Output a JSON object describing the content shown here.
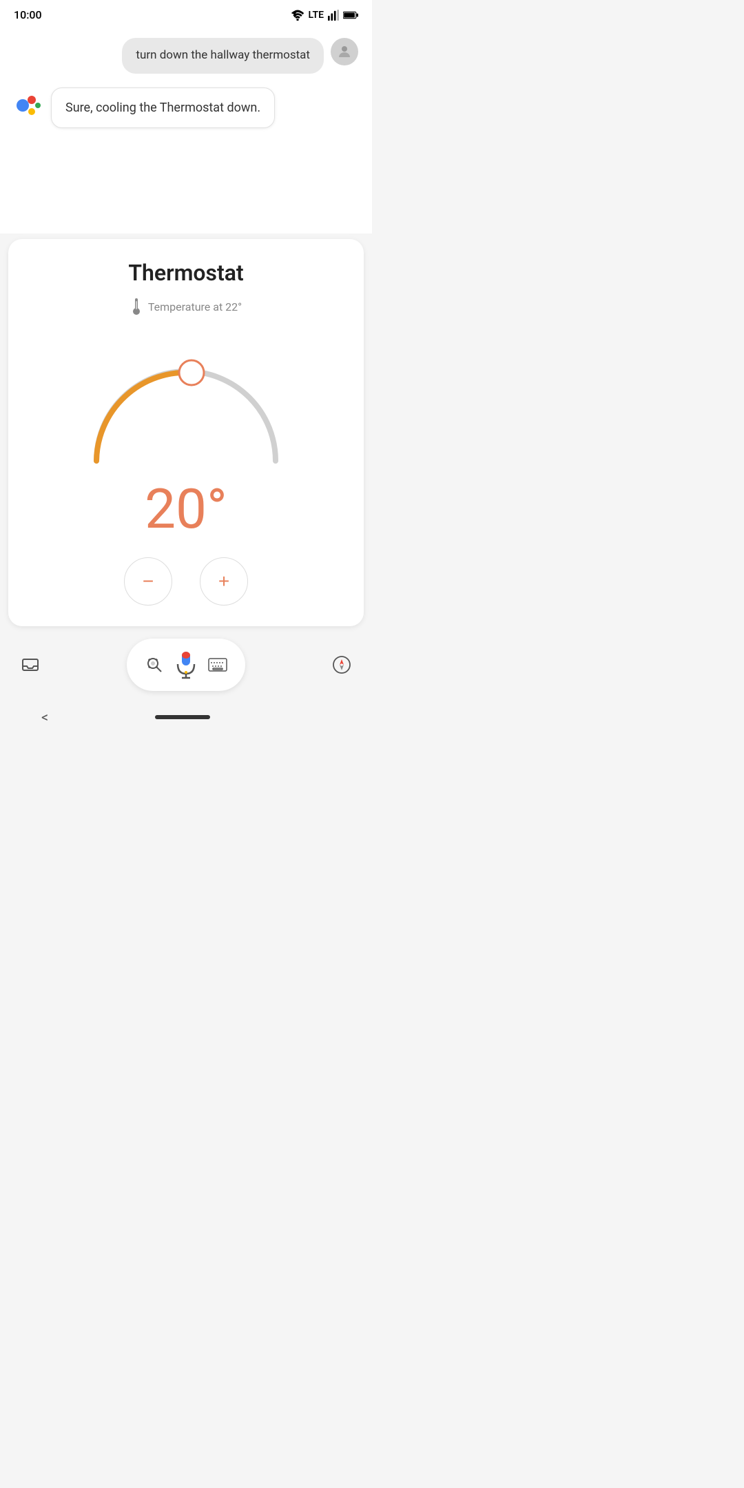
{
  "statusBar": {
    "time": "10:00",
    "wifi": true,
    "lte": "LTE",
    "signal": true,
    "battery": true
  },
  "userMessage": {
    "text": "turn down the hallway thermostat",
    "avatarAlt": "user avatar"
  },
  "assistantMessage": {
    "text": "Sure, cooling the Thermostat down."
  },
  "thermostatCard": {
    "title": "Thermostat",
    "tempLabel": "Temperature at 22°",
    "currentTemp": "20°",
    "minTemp": 10,
    "maxTemp": 30,
    "setTemp": 20,
    "decreaseLabel": "−",
    "increaseLabel": "+"
  },
  "toolbar": {
    "searchLabel": "search",
    "micLabel": "microphone",
    "keyboardLabel": "keyboard"
  },
  "nav": {
    "backLabel": "<"
  }
}
